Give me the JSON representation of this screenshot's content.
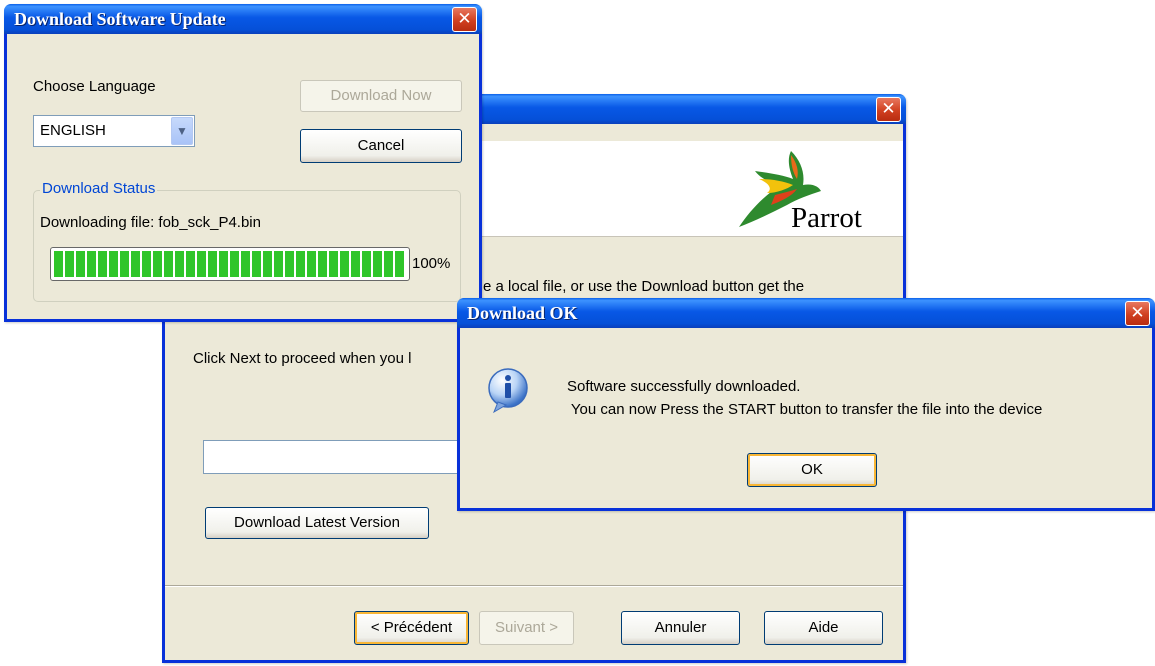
{
  "wizard": {
    "title": "",
    "close_icon": "close-icon",
    "logo_text": "Parrot",
    "instruction_partial": "e a local file, or use the Download button get the",
    "next_instruction": "Click Next to proceed when you l",
    "file_path_value": "",
    "download_latest_label": "Download Latest Version",
    "prev_label": "< Précédent",
    "next_label": "Suivant >",
    "cancel_label": "Annuler",
    "help_label": "Aide"
  },
  "download_dialog": {
    "title": "Download Software Update",
    "close_icon": "close-icon",
    "choose_language_label": "Choose Language",
    "language_selected": "ENGLISH",
    "download_now_label": "Download Now",
    "cancel_label": "Cancel",
    "status_group_label": "Download Status",
    "status_text": "Downloading file: fob_sck_P4.bin",
    "progress_fraction": 1.0,
    "progress_label": "100%",
    "colors": {
      "progress_fill": "#22c520",
      "group_label": "#0046d5"
    }
  },
  "ok_dialog": {
    "title": "Download OK",
    "close_icon": "close-icon",
    "info_icon": "info-icon",
    "message_line1": "Software successfully downloaded.",
    "message_line2": " You can now Press the START button to transfer the file into the device",
    "ok_label": "OK"
  }
}
